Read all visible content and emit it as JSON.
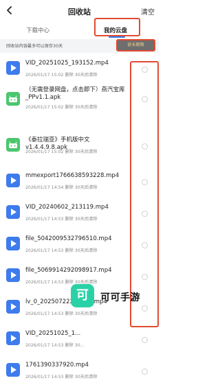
{
  "header": {
    "title": "回收站",
    "clear_label": "清空",
    "back_icon": "chevron-left-icon"
  },
  "tabs": [
    {
      "label": "下载中心",
      "active": false
    },
    {
      "label": "我的云盘",
      "active": true
    }
  ],
  "notice": {
    "text": "回收站内容最多可以保存30天",
    "extend_label": "延长期限"
  },
  "files": [
    {
      "name": "VID_20251025_193152.mp4",
      "meta": "2026/01/17 15:02 删除 30天后清除",
      "type": "video"
    },
    {
      "name": "（无需登录网盘，点击即下）燕汽宝库_PPv1.1.apk",
      "meta": "2026/01/17 15:02 删除 30天后清除",
      "type": "apk"
    },
    {
      "name": "《泰拉瑞亚》手机版中文v1.4.4.9.8.apk",
      "meta": "2026/01/17 15:02 删除 30天后清除",
      "type": "apk"
    },
    {
      "name": "mmexport1766638593228.mp4",
      "meta": "2026/01/17 14:54 删除 30天后清除",
      "type": "video"
    },
    {
      "name": "VID_20240602_213119.mp4",
      "meta": "2026/01/17 14:53 删除 30天后清除",
      "type": "video"
    },
    {
      "name": "file_5042009532796510.mp4",
      "meta": "2026/01/17 14:53 删除 30天后清除",
      "type": "video"
    },
    {
      "name": "file_5069914292098917.mp4",
      "meta": "2026/01/17 14:53 删除 30天后清除",
      "type": "video"
    },
    {
      "name": "lv_0_20250722212149.mp4",
      "meta": "2026/01/17 14:53 删除 30天后清除",
      "type": "video"
    },
    {
      "name": "VID_20251025_1...",
      "meta": "2026/01/17 14:53 删除 30...",
      "type": "video"
    },
    {
      "name": "1761390337920.mp4",
      "meta": "2026/01/17 14:53 删除 30天后清除",
      "type": "video"
    }
  ],
  "watermark": {
    "logo_text": "可",
    "text": "可可手游"
  },
  "colors": {
    "accent": "#2b7cf6",
    "highlight": "#e04a2f",
    "video_icon": "#3e7bec",
    "apk_icon": "#4cc66e",
    "extend_button": "#e2ba6e"
  }
}
